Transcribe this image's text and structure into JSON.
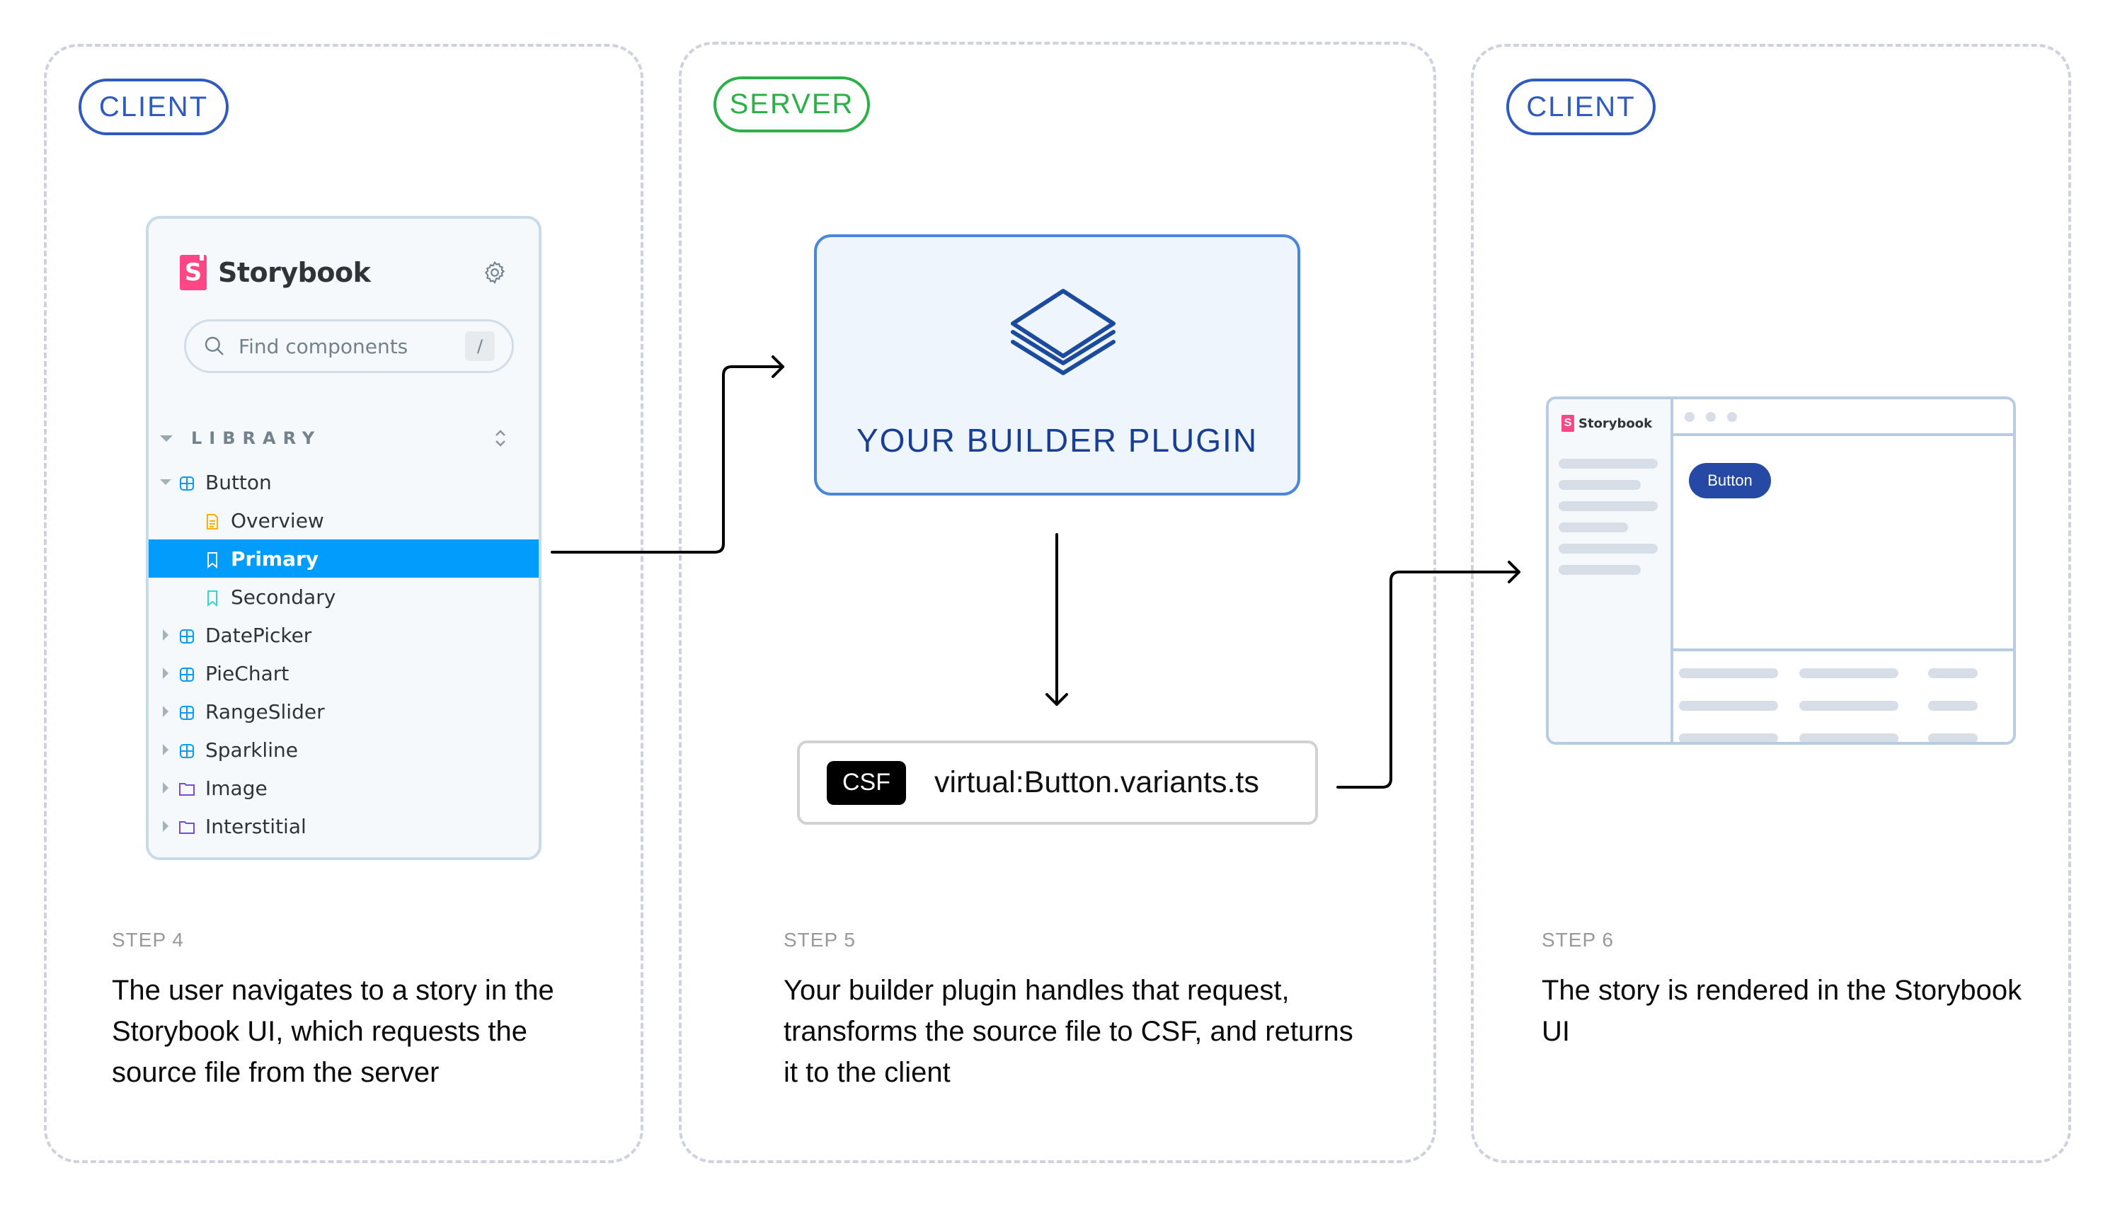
{
  "panels": [
    {
      "badge": "CLIENT",
      "step_label": "STEP 4",
      "step_text": "The user navigates to a story in the Storybook UI, which requests the source file from the server"
    },
    {
      "badge": "SERVER",
      "step_label": "STEP 5",
      "step_text": "Your builder plugin handles that request, transforms the source file to CSF, and returns it to the client"
    },
    {
      "badge": "CLIENT",
      "step_label": "STEP 6",
      "step_text": "The story is rendered in the Storybook UI"
    }
  ],
  "colors": {
    "client": "#2f5bbf",
    "server": "#2cb14a",
    "selected": "#029cfd",
    "storybook_pink": "#ff4785",
    "plugin_text": "#183f94"
  },
  "storybook_sidebar": {
    "logo_letter": "S",
    "title": "Storybook",
    "settings_icon": "gear-icon",
    "search": {
      "placeholder": "Find components",
      "shortcut": "/"
    },
    "section_label": "LIBRARY",
    "tree": [
      {
        "label": "Button",
        "type": "component",
        "expanded": true,
        "level": 1
      },
      {
        "label": "Overview",
        "type": "docs",
        "level": 2
      },
      {
        "label": "Primary",
        "type": "story",
        "level": 2,
        "selected": true
      },
      {
        "label": "Secondary",
        "type": "story",
        "level": 2
      },
      {
        "label": "DatePicker",
        "type": "component",
        "level": 1
      },
      {
        "label": "PieChart",
        "type": "component",
        "level": 1
      },
      {
        "label": "RangeSlider",
        "type": "component",
        "level": 1
      },
      {
        "label": "Sparkline",
        "type": "component",
        "level": 1
      },
      {
        "label": "Image",
        "type": "folder",
        "level": 1
      },
      {
        "label": "Interstitial",
        "type": "folder",
        "level": 1
      }
    ]
  },
  "builder_plugin": {
    "icon": "layers-icon",
    "label": "YOUR BUILDER PLUGIN"
  },
  "csf_file": {
    "tag": "CSF",
    "filename": "virtual:Button.variants.ts"
  },
  "rendered_ui": {
    "logo_letter": "S",
    "title": "Storybook",
    "button_label": "Button"
  }
}
